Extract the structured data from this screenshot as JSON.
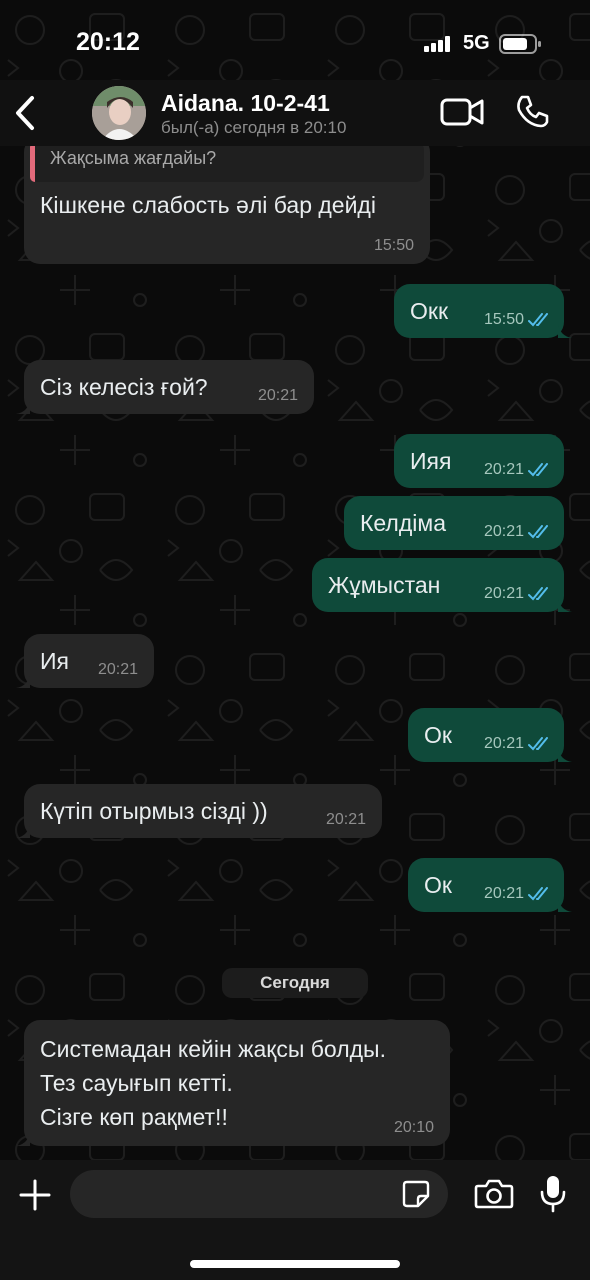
{
  "status_bar": {
    "time": "20:12",
    "network": "5G"
  },
  "header": {
    "contact_name": "Aidana. 10-2-41",
    "contact_status": "был(-а) сегодня в 20:10"
  },
  "chat": {
    "quoted_text": "Жақсыма жағдайы?",
    "messages": [
      {
        "direction": "in",
        "text": "Кішкене слабость әлі бар дейді",
        "time": "15:50"
      },
      {
        "direction": "out",
        "text": "Окк",
        "time": "15:50",
        "status": "read"
      },
      {
        "direction": "in",
        "text": "Сіз келесіз ғой?",
        "time": "20:21"
      },
      {
        "direction": "out",
        "text": "Ияя",
        "time": "20:21",
        "status": "read"
      },
      {
        "direction": "out",
        "text": "Келдіма",
        "time": "20:21",
        "status": "read"
      },
      {
        "direction": "out",
        "text": "Жұмыстан",
        "time": "20:21",
        "status": "read"
      },
      {
        "direction": "in",
        "text": "Ия",
        "time": "20:21"
      },
      {
        "direction": "out",
        "text": "Ок",
        "time": "20:21",
        "status": "read"
      },
      {
        "direction": "in",
        "text": "Күтіп отырмыз сізді ))",
        "time": "20:21"
      },
      {
        "direction": "out",
        "text": "Ок",
        "time": "20:21",
        "status": "read"
      }
    ],
    "date_divider": "Сегодня",
    "last_message": {
      "direction": "in",
      "lines": [
        "Системадан кейін жақсы болды.",
        "Тез сауығып кетті.",
        "Сізге көп рақмет!!"
      ],
      "time": "20:10"
    }
  },
  "input": {
    "placeholder": "",
    "value": ""
  },
  "icons": [
    "back-chevron-icon",
    "video-camera-icon",
    "phone-icon",
    "plus-icon",
    "sticker-icon",
    "camera-icon",
    "microphone-icon",
    "double-check-icon"
  ],
  "colors": {
    "background": "#0b0b0b",
    "incoming_bubble": "#262626",
    "outgoing_bubble": "#0f4a3a",
    "read_ticks": "#53bdeb",
    "quote_accent": "#e26a7b"
  }
}
